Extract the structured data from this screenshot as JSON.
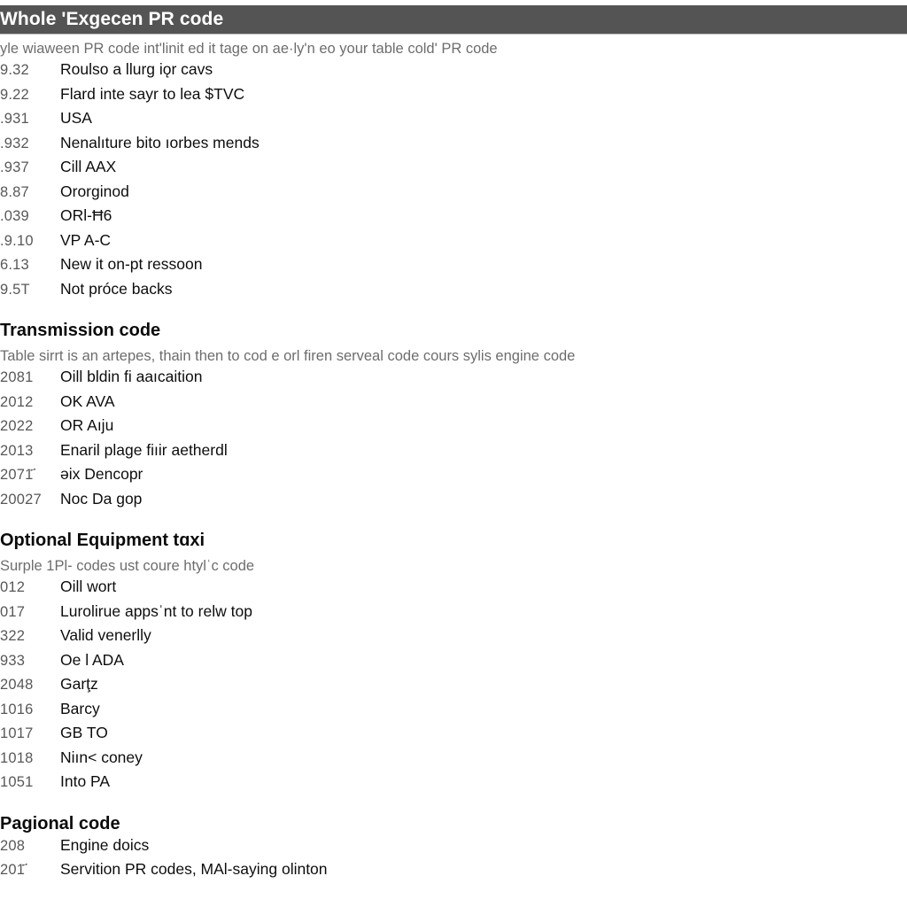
{
  "document": {
    "banner_title": "Whole 'Exgecen PR code",
    "intro_text": "yle wiaween PR code int'linit ed it tage on ae·ly'n eo your table cold' PR code"
  },
  "sections": [
    {
      "title": "Whole 'Exgecen PR code",
      "is_banner": true,
      "description": "yle wiaween PR code int'linit ed it tage on ae·ly'n eo your table cold' PR code",
      "rows": [
        {
          "code": "9.32",
          "label": "Roulso a llurg iǫr cavs"
        },
        {
          "code": "9.22",
          "label": "Flard inte sayr to lea $TVC"
        },
        {
          "code": ".931",
          "label": "USA"
        },
        {
          "code": ".932",
          "label": "Nenalıture bito ıorbes mends"
        },
        {
          "code": ".937",
          "label": "Cill AAX"
        },
        {
          "code": "8.87",
          "label": "Ororɡinod"
        },
        {
          "code": ".039",
          "label": "ORl-Ħ6"
        },
        {
          "code": ".9.10",
          "label": "VP A-C"
        },
        {
          "code": "6.13",
          "label": "New it on-pt ressoon"
        },
        {
          "code": "9.5T",
          "label": "Not próce backs"
        }
      ]
    },
    {
      "title": "Transmission code",
      "is_banner": false,
      "description": "Table sirrt is an artepes, thain then to cod e orl firen serveal code cours sylis engine code",
      "rows": [
        {
          "code": "2081",
          "label": "Oill bldin fi aaıcaition"
        },
        {
          "code": "2012",
          "label": "OK AVA"
        },
        {
          "code": "2022",
          "label": "OR Aıju"
        },
        {
          "code": "2013",
          "label": "Enaril plage fiıir aetherdl"
        },
        {
          "code": "2071҃",
          "label": "ǝix Dencopr"
        },
        {
          "code": "20027",
          "label": "Noс Da gop"
        }
      ]
    },
    {
      "title": "Optional Equipment tɑxi",
      "is_banner": false,
      "description": "Surple 1Pl- codes ust coure htylˈc code",
      "rows": [
        {
          "code": "012",
          "label": "Oill wort"
        },
        {
          "code": "017",
          "label": "Lurolirue appsˈnt to relw top"
        },
        {
          "code": "322",
          "label": "Valid venerlly"
        },
        {
          "code": "933",
          "label": "Oe l ADA"
        },
        {
          "code": "2048",
          "label": "Garţz"
        },
        {
          "code": "1016",
          "label": "Barcy"
        },
        {
          "code": "1017",
          "label": "GB TO"
        },
        {
          "code": "1018",
          "label": "Niın˂ coney"
        },
        {
          "code": "1051",
          "label": "Into PA"
        }
      ]
    },
    {
      "title": "Рagional code",
      "is_banner": false,
      "description": "",
      "rows": [
        {
          "code": "208",
          "label": "Engine doiсs"
        },
        {
          "code": "201҃",
          "label": "Servition PR codes, MAl-saying olinton"
        }
      ]
    }
  ],
  "colors": {
    "banner_background": "#565656",
    "banner_text": "#ffffff",
    "page_background": "#fdfdfd",
    "code_number_text": "#59595b",
    "code_label_text": "#131313",
    "description_text": "#6d6d6d",
    "heading_text": "#111111"
  }
}
